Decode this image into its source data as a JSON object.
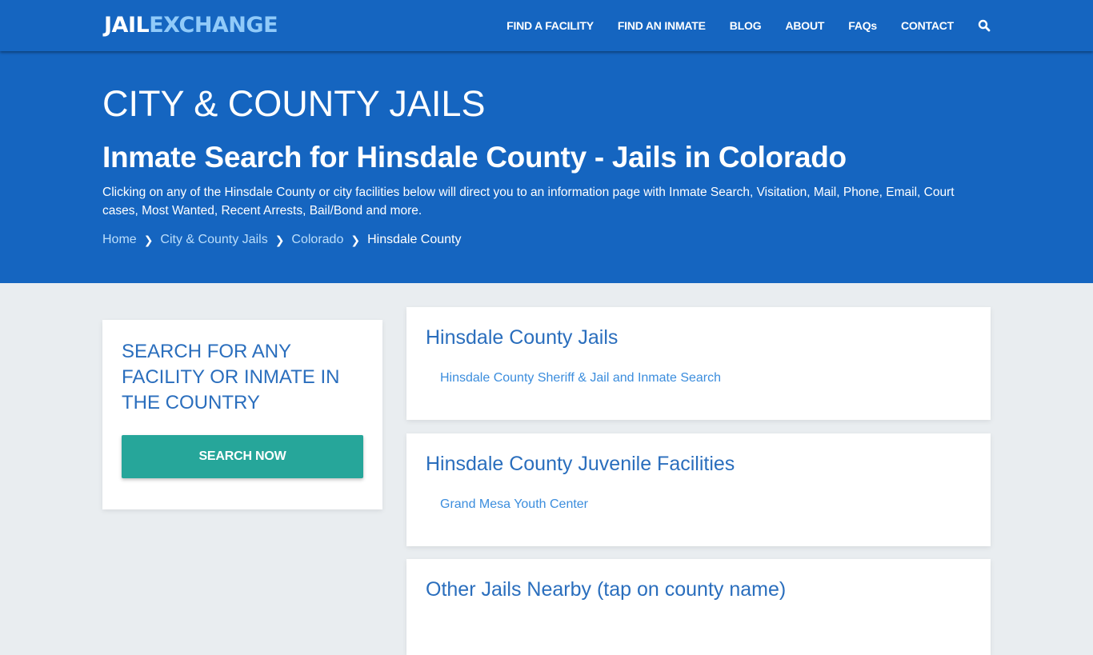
{
  "header": {
    "logo_part1": "JAIL",
    "logo_part2": "EXCHANGE",
    "nav": [
      {
        "label": "FIND A FACILITY"
      },
      {
        "label": "FIND AN INMATE"
      },
      {
        "label": "BLOG"
      },
      {
        "label": "ABOUT"
      },
      {
        "label": "FAQs"
      },
      {
        "label": "CONTACT"
      }
    ],
    "search_icon": "search-icon"
  },
  "hero": {
    "title": "CITY & COUNTY JAILS",
    "subtitle": "Inmate Search for Hinsdale County - Jails in Colorado",
    "description": "Clicking on any of the Hinsdale County or city facilities below will direct you to an information page with Inmate Search, Visitation, Mail, Phone, Email, Court cases, Most Wanted, Recent Arrests, Bail/Bond and more.",
    "breadcrumb": [
      {
        "label": "Home"
      },
      {
        "label": "City & County Jails"
      },
      {
        "label": "Colorado"
      },
      {
        "label": "Hinsdale County"
      }
    ]
  },
  "sidebar": {
    "heading": "SEARCH FOR ANY FACILITY OR INMATE IN THE COUNTRY",
    "button_label": "SEARCH NOW"
  },
  "sections": [
    {
      "title": "Hinsdale County Jails",
      "links": [
        "Hinsdale County Sheriff & Jail and Inmate Search"
      ]
    },
    {
      "title": "Hinsdale County Juvenile Facilities",
      "links": [
        "Grand Mesa Youth Center"
      ]
    },
    {
      "title": "Other Jails Nearby (tap on county name)",
      "links": []
    }
  ],
  "colors": {
    "primary": "#1565c0",
    "logo_accent": "#90caf9",
    "button": "#26a69a",
    "heading": "#2a6ebd",
    "link": "#3b8ddd",
    "background": "#e9edf0"
  }
}
